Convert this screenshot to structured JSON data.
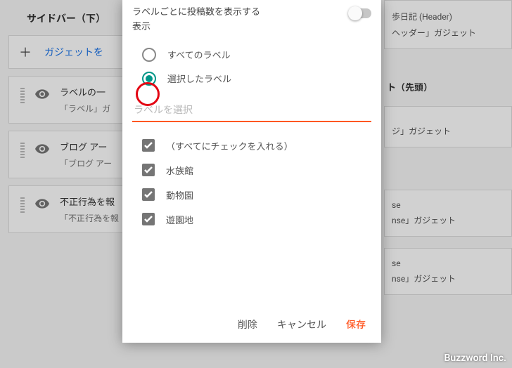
{
  "watermark": "Buzzword Inc.",
  "background": {
    "left": {
      "section_title": "サイドバー（下）",
      "add_gadget": "ガジェットを",
      "cards": [
        {
          "title": "ラベルの一",
          "subtitle": "「ラベル」ガ"
        },
        {
          "title": "ブログ アー",
          "subtitle": "「ブログ アー"
        },
        {
          "title": "不正行為を報",
          "subtitle": "「不正行為を報"
        }
      ]
    },
    "right": {
      "header_line1": "歩日記 (Header)",
      "header_line2": "ヘッダー」ガジェット",
      "section_title": "ト（先頭）",
      "card1": "ジ」ガジェット",
      "card2a": "se",
      "card2b": "nse」ガジェット",
      "card3a": "se",
      "card3b": "nse」ガジェット"
    }
  },
  "dialog": {
    "option_label": "ラベルごとに投稿数を表示する",
    "display_heading": "表示",
    "radio": {
      "all": "すべてのラベル",
      "selected": "選択したラベル"
    },
    "label_select_placeholder": "ラベルを選択",
    "check_all": "（すべてにチェックを入れる）",
    "labels": [
      "水族館",
      "動物園",
      "遊園地"
    ],
    "actions": {
      "delete": "削除",
      "cancel": "キャンセル",
      "save": "保存"
    }
  }
}
